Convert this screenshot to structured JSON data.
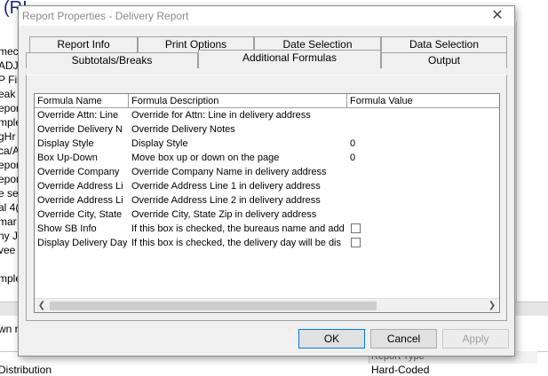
{
  "background": {
    "title": "(RI",
    "left_list": [
      "mec",
      "ADJ",
      "P Fil",
      "eak",
      "epor",
      "mple",
      "gHr",
      "ca/A",
      "epor",
      "epor",
      "e se",
      "al 4(",
      "mar",
      "ny J",
      "vee",
      "",
      "mple"
    ],
    "lower_text": "wn r",
    "bottom_header": "Report Type",
    "bottom_left": "Distribution",
    "bottom_right": "Hard-Coded"
  },
  "dialog": {
    "title": "Report Properties - Delivery Report",
    "close_glyph": "✕",
    "tabs_row1": [
      "Report Info",
      "Print Options",
      "Date Selection",
      "Data Selection"
    ],
    "tabs_row2": [
      "Subtotals/Breaks",
      "Additional Formulas",
      "Output"
    ],
    "active_tab": "Additional Formulas",
    "grid": {
      "columns": [
        "Formula Name",
        "Formula Description",
        "Formula Value"
      ],
      "rows": [
        {
          "name": "Override Attn: Line",
          "desc": "Override for Attn: Line in delivery address",
          "value": ""
        },
        {
          "name": "Override Delivery N",
          "desc": "Override Delivery Notes",
          "value": ""
        },
        {
          "name": "Display Style",
          "desc": "Display Style",
          "value": "0"
        },
        {
          "name": "Box Up-Down",
          "desc": "Move box up or down on the page",
          "value": "0"
        },
        {
          "name": "Override Company",
          "desc": "Override Company Name in delivery address",
          "value": ""
        },
        {
          "name": "Override Address Li",
          "desc": "Override Address Line 1 in delivery address",
          "value": ""
        },
        {
          "name": "Override Address Li",
          "desc": "Override Address Line 2 in delivery address",
          "value": ""
        },
        {
          "name": "Override City, State",
          "desc": "Override City, State Zip in delivery address",
          "value": ""
        },
        {
          "name": "Show SB Info",
          "desc": "If this box is checked, the bureaus name and add",
          "value": "",
          "checkbox": true
        },
        {
          "name": "Display Delivery Day",
          "desc": "If this box is checked, the delivery day will be dis",
          "value": "",
          "checkbox": true
        }
      ]
    },
    "buttons": {
      "ok": "OK",
      "cancel": "Cancel",
      "apply": "Apply"
    }
  }
}
